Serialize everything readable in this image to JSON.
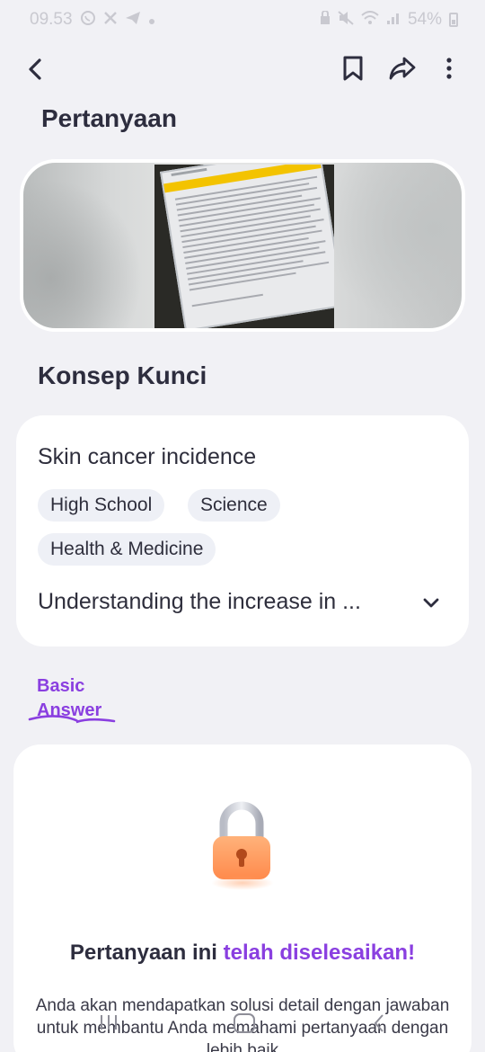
{
  "status_bar": {
    "time": "09.53",
    "battery": "54%"
  },
  "header": {
    "question_title": "Pertanyaan",
    "concept_title": "Konsep Kunci"
  },
  "concept": {
    "topic": "Skin cancer incidence",
    "tags": [
      "High School",
      "Science",
      "Health & Medicine"
    ],
    "summary": "Understanding the increase in ..."
  },
  "answer_tab": {
    "label": "Basic Answer"
  },
  "answer": {
    "heading_prefix": "Pertanyaan ini ",
    "heading_accent": "telah diselesaikan!",
    "description": "Anda akan mendapatkan solusi detail dengan jawaban untuk membantu Anda memahami pertanyaan dengan lebih baik"
  },
  "colors": {
    "accent": "#8a3fe0",
    "background": "#f1f1f5",
    "chip": "#eef0f6"
  }
}
